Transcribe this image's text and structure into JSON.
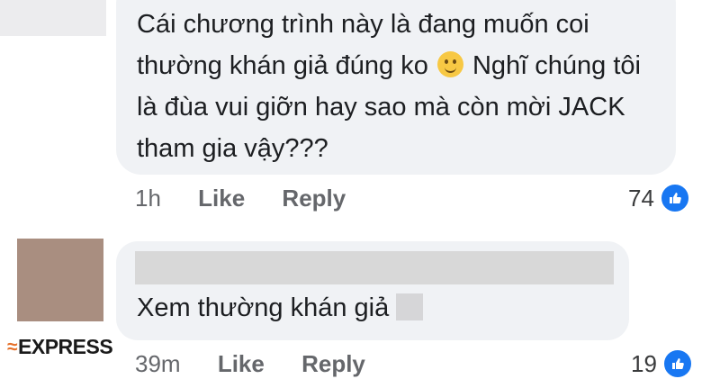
{
  "comment": {
    "text_part1": "Cái chương trình này là đang muốn coi thường khán giả đúng ko",
    "text_part2": "Nghĩ chúng tôi là đùa vui giỡn hay sao mà còn mời JACK tham gia vậy???",
    "emoji_icon": "slightly-smiling-face-icon",
    "time": "1h",
    "like_label": "Like",
    "reply_label": "Reply",
    "reaction_count": "74",
    "reaction_icon": "thumbs-up-icon"
  },
  "reply": {
    "text": "Xem thường khán giả",
    "time": "39m",
    "like_label": "Like",
    "reply_label": "Reply",
    "reaction_count": "19",
    "reaction_icon": "thumbs-up-icon"
  },
  "watermark": {
    "text": "EXPRESS"
  },
  "colors": {
    "bubble": "#f0f2f5",
    "like_blue": "#1877f2",
    "meta_gray": "#65676b"
  }
}
